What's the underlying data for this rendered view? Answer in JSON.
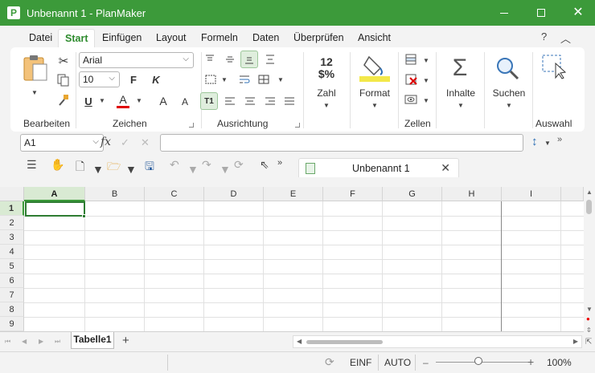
{
  "window": {
    "title": "Unbenannt 1 - PlanMaker",
    "app_icon_letter": "P"
  },
  "menu": {
    "tabs": [
      "Datei",
      "Start",
      "Einfügen",
      "Layout",
      "Formeln",
      "Daten",
      "Überprüfen",
      "Ansicht"
    ],
    "active_tab": "Start",
    "help": "?"
  },
  "ribbon": {
    "font_name": "Arial",
    "font_size": "10",
    "bold_label": "F",
    "italic_label": "K",
    "underline_label": "U",
    "font_color_label": "A",
    "grow_font_label": "A",
    "shrink_font_label": "A",
    "number_format_top": "12",
    "number_format_bottom": "$%",
    "buttons": {
      "zahl": "Zahl",
      "format": "Format",
      "inhalte": "Inhalte",
      "suchen": "Suchen"
    },
    "groups": [
      "Bearbeiten",
      "Zeichen",
      "Ausrichtung",
      "Zellen",
      "Auswahl"
    ],
    "accent_colors": {
      "font_color": "#e00000",
      "format_fill": "#f3e84a",
      "brand": "#3c9a3a"
    }
  },
  "formula_bar": {
    "cell_ref": "A1",
    "fx_label": "fx",
    "content": ""
  },
  "document": {
    "tab_name": "Unbenannt 1"
  },
  "grid": {
    "columns": [
      "A",
      "B",
      "C",
      "D",
      "E",
      "F",
      "G",
      "H",
      "I"
    ],
    "rows": [
      "1",
      "2",
      "3",
      "4",
      "5",
      "6",
      "7",
      "8",
      "9"
    ],
    "selected_cell": "A1"
  },
  "sheets": {
    "tabs": [
      "Tabelle1"
    ],
    "add": "+"
  },
  "status": {
    "insert_mode": "EINF",
    "calc_mode": "AUTO",
    "zoom": "100%",
    "zoom_minus": "–",
    "zoom_plus": "+"
  }
}
